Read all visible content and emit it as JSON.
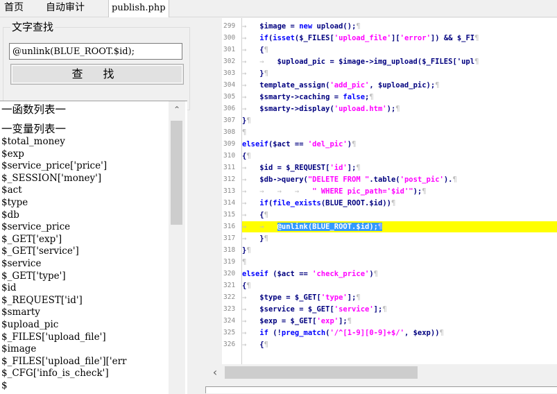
{
  "tabs": [
    "首页",
    "自动审计",
    "publish.php"
  ],
  "search": {
    "legend": "文字查找",
    "value": "@unlink(BLUE_ROOT.$id);",
    "button": "查 找"
  },
  "list": {
    "func_heading": "一函数列表一",
    "var_heading": "一变量列表一",
    "vars": [
      "$total_money",
      "$exp",
      "$service_price['price']",
      "$_SESSION['money']",
      "$act",
      "$type",
      "$db",
      "$service_price",
      "$_GET['exp']",
      "$_GET['service']",
      "$service",
      "$_GET['type']",
      "$id",
      "$_REQUEST['id']",
      "$smarty",
      "$upload_pic",
      "$_FILES['upload_file']",
      "$image",
      "$_FILES['upload_file']['err",
      "$_CFG['info_is_check']",
      "$"
    ]
  },
  "editor": {
    "highlight_line": 316,
    "lines": [
      {
        "n": "299",
        "t": "    $image = new upload();"
      },
      {
        "n": "300",
        "t": "    if(isset($_FILES['upload_file']['error']) && $_FI"
      },
      {
        "n": "301",
        "t": "    {"
      },
      {
        "n": "302",
        "t": "        $upload_pic = $image->img_upload($_FILES['upl"
      },
      {
        "n": "303",
        "t": "    }"
      },
      {
        "n": "304",
        "t": "    template_assign('add_pic', $upload_pic);"
      },
      {
        "n": "305",
        "t": "    $smarty->caching = false;"
      },
      {
        "n": "306",
        "t": "    $smarty->display('upload.htm');"
      },
      {
        "n": "307",
        "t": "}"
      },
      {
        "n": "308",
        "t": ""
      },
      {
        "n": "309",
        "t": "elseif($act == 'del_pic')"
      },
      {
        "n": "310",
        "t": "{"
      },
      {
        "n": "311",
        "t": "    $id = $_REQUEST['id'];"
      },
      {
        "n": "312",
        "t": "    $db->query(\"DELETE FROM \".table('post_pic')."
      },
      {
        "n": "313",
        "t": "                \" WHERE pic_path='$id'\");"
      },
      {
        "n": "314",
        "t": "    if(file_exists(BLUE_ROOT.$id))"
      },
      {
        "n": "315",
        "t": "    {"
      },
      {
        "n": "316",
        "t": "        @unlink(BLUE_ROOT.$id);"
      },
      {
        "n": "317",
        "t": "    }"
      },
      {
        "n": "318",
        "t": "}"
      },
      {
        "n": "319",
        "t": ""
      },
      {
        "n": "320",
        "t": "elseif ($act == 'check_price')"
      },
      {
        "n": "321",
        "t": "{"
      },
      {
        "n": "322",
        "t": "    $type = $_GET['type'];"
      },
      {
        "n": "323",
        "t": "    $service = $_GET['service'];"
      },
      {
        "n": "324",
        "t": "    $exp = $_GET['exp'];"
      },
      {
        "n": "325",
        "t": "    if (!preg_match('/^[1-9][0-9]+$/', $exp))"
      },
      {
        "n": "326",
        "t": "    {"
      }
    ]
  },
  "icons": {
    "list_scroll_up": "chevron-up-icon",
    "hscroll_left": "chevron-left-icon"
  }
}
